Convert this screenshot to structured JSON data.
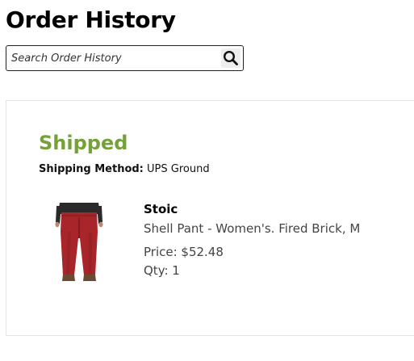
{
  "page_title": "Order History",
  "search": {
    "placeholder": "Search Order History",
    "icon": "search-icon"
  },
  "order": {
    "status": "Shipped",
    "status_color": "#76a13a",
    "shipping_method_label": "Shipping Method:",
    "shipping_method_value": "UPS Ground",
    "item": {
      "brand": "Stoic",
      "description": "Shell Pant - Women's. Fired Brick, M",
      "price": "Price: $52.48",
      "quantity": "Qty: 1",
      "image": "product-image-red-pants",
      "image_color": "#a8262a"
    }
  }
}
